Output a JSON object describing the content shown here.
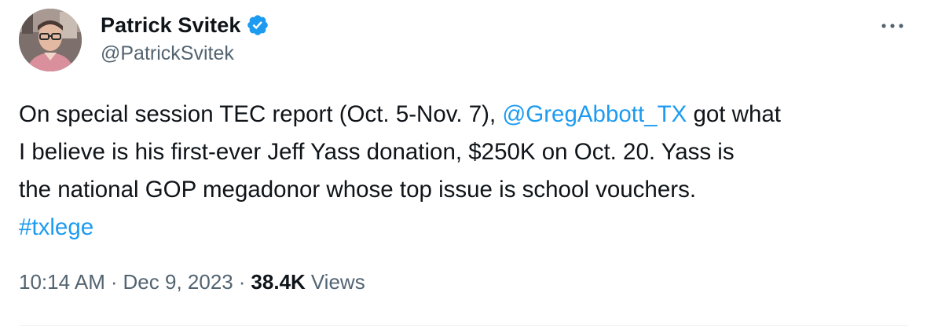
{
  "author": {
    "name": "Patrick Svitek",
    "handle": "@PatrickSvitek",
    "verified": true
  },
  "colors": {
    "link": "#1d9bf0",
    "text": "#0f1419",
    "secondary": "#536471",
    "verified_badge": "#1d9bf0"
  },
  "icons": {
    "verified": "verified-badge-icon",
    "more": "more-horizontal-icon"
  },
  "tweet": {
    "line1_a": "On special session TEC report (Oct. 5-Nov. 7), ",
    "line1_mention": "@GregAbbott_TX",
    "line1_b": " got what",
    "line2": "I believe is his first-ever Jeff Yass donation, $250K on Oct. 20. Yass is",
    "line3": "the national GOP megadonor whose top issue is school vouchers.",
    "hashtag": "#txlege"
  },
  "meta": {
    "time": "10:14 AM",
    "separator": "·",
    "date": "Dec 9, 2023",
    "views_count": "38.4K",
    "views_label": "Views"
  }
}
